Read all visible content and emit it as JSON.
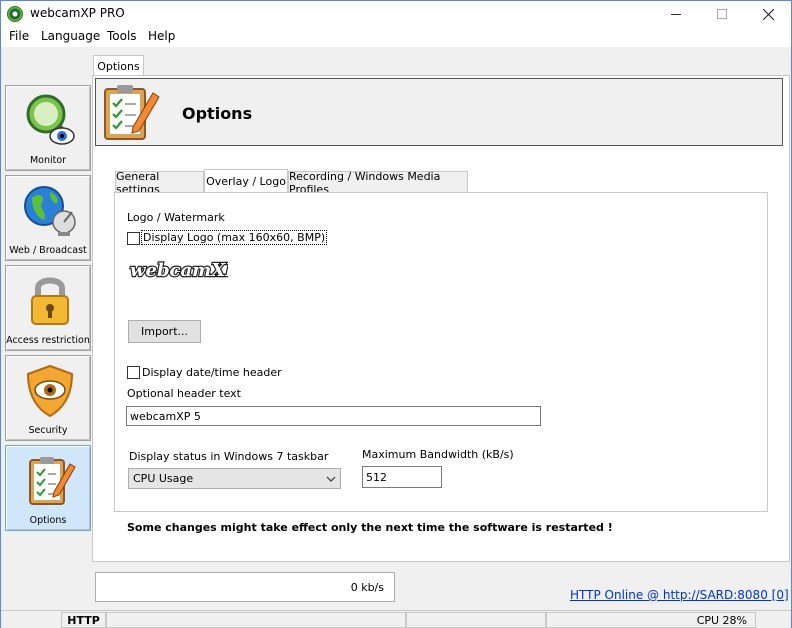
{
  "window": {
    "title": "webcamXP PRO"
  },
  "menu": [
    "File",
    "Language",
    "Tools",
    "Help"
  ],
  "nav": [
    {
      "label": "Monitor",
      "icon": "magnifier-eye-icon",
      "active": false
    },
    {
      "label": "Web / Broadcast",
      "icon": "globe-satellite-icon",
      "active": false
    },
    {
      "label": "Access restriction",
      "icon": "padlock-icon",
      "active": false
    },
    {
      "label": "Security",
      "icon": "shield-eye-icon",
      "active": false
    },
    {
      "label": "Options",
      "icon": "clipboard-pencil-icon",
      "active": true
    }
  ],
  "main_tab": "Options",
  "header": {
    "title": "Options"
  },
  "tabs": [
    "General settings",
    "Overlay / Logo",
    "Recording / Windows Media Profiles"
  ],
  "overlay": {
    "section_label": "Logo / Watermark",
    "display_logo_label": "Display Logo (max 160x60, BMP)",
    "display_logo_checked": false,
    "logo_text": "webcamXP",
    "import_button": "Import...",
    "display_datetime_label": "Display date/time header",
    "display_datetime_checked": false,
    "header_text_label": "Optional header text",
    "header_text_value": "webcamXP 5",
    "taskbar_label": "Display status in Windows 7 taskbar",
    "taskbar_value": "CPU Usage",
    "bandwidth_label": "Maximum Bandwidth (kB/s)",
    "bandwidth_value": "512"
  },
  "restart_note": "Some changes might take effect only the next time the software is restarted !",
  "rate": "0 kb/s",
  "http_status": "HTTP Online @ http://SARD:8080 [0]",
  "statusbar": {
    "http": "HTTP",
    "cpu": "CPU 28%"
  },
  "colors": {
    "accent": "#0078d7",
    "active_nav": "#cfe6fb",
    "link": "#0033cc"
  }
}
